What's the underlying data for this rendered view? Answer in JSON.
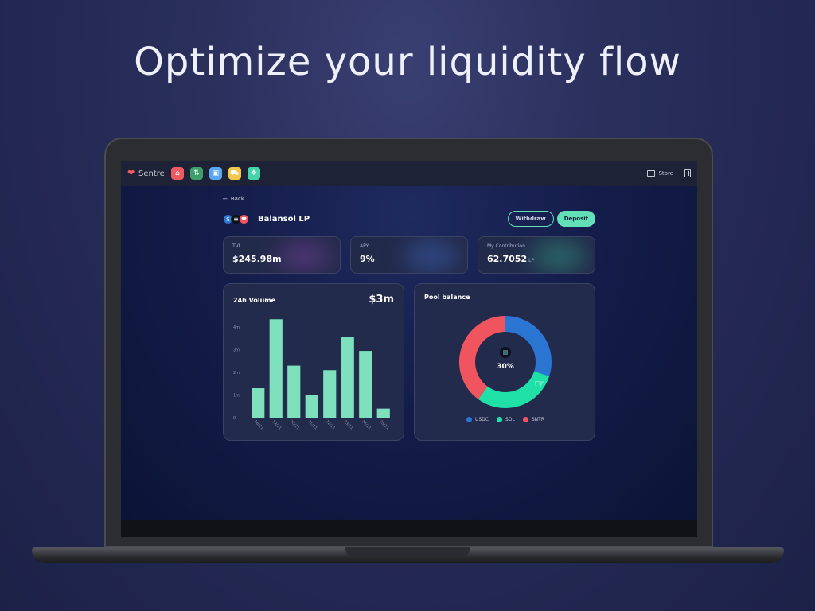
{
  "headline": "Optimize your liquidity flow",
  "topbar": {
    "brand": "Sentre",
    "store_label": "Store",
    "apps": [
      {
        "icon": "home-icon",
        "color": "#ee5a63"
      },
      {
        "icon": "swap-icon",
        "color": "#3f9e6a"
      },
      {
        "icon": "wallet-icon",
        "color": "#5aa6f0"
      },
      {
        "icon": "tractor-icon",
        "color": "#f2c64a"
      },
      {
        "icon": "puzzle-icon",
        "color": "#45d6a8"
      }
    ]
  },
  "page": {
    "back_label": "Back",
    "pool_name": "Balansol LP",
    "withdraw_label": "Withdraw",
    "deposit_label": "Deposit"
  },
  "stats": {
    "tvl": {
      "label": "TVL",
      "value": "$245.98m"
    },
    "apy": {
      "label": "APY",
      "value": "9%"
    },
    "contribution": {
      "label": "My Contribution",
      "value": "62.7052",
      "unit": "LP"
    }
  },
  "volume": {
    "title": "24h Volume",
    "total": "$3m"
  },
  "pool_balance": {
    "title": "Pool balance",
    "center_label": "30%"
  },
  "colors": {
    "accent": "#63e0b8",
    "usdc": "#2a76d2",
    "sol": "#1fe0a6",
    "sntr": "#f0555f",
    "bar": "#7fe0bd"
  },
  "chart_data": [
    {
      "type": "bar",
      "title": "24h Volume",
      "categories": [
        "18/11",
        "19/11",
        "20/11",
        "21/11",
        "22/11",
        "23/11",
        "24/11",
        "25/11"
      ],
      "values": [
        1.3,
        4.35,
        2.3,
        1.0,
        2.1,
        3.55,
        2.95,
        0.4
      ],
      "y_ticks": [
        "0",
        "1m",
        "2m",
        "3m",
        "4m"
      ],
      "ylim": [
        0,
        4.5
      ],
      "grid": false
    },
    {
      "type": "pie",
      "title": "Pool balance",
      "labels": [
        "USDC",
        "SOL",
        "SNTR"
      ],
      "values": [
        30,
        30,
        40
      ],
      "center_text": "30%",
      "legend": "bottom"
    }
  ]
}
